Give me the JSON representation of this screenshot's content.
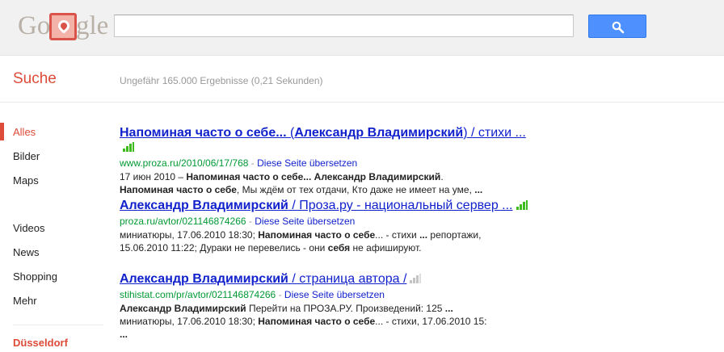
{
  "header": {
    "logo_left": "Go",
    "logo_right": "gle",
    "search_value": "",
    "search_button_icon": "search-icon"
  },
  "subheader": {
    "section_title": "Suche",
    "stats": "Ungefähr 165.000 Ergebnisse (0,21 Sekunden)"
  },
  "nav": {
    "items": [
      "Alles",
      "Bilder",
      "Maps",
      "Videos",
      "News",
      "Shopping",
      "Mehr"
    ],
    "active": "Alles",
    "location": "Düsseldorf"
  },
  "results": [
    {
      "title_parts": [
        "Напоминая часто о себе...",
        " (",
        "Александр Владимирский",
        ") / стихи ..."
      ],
      "url": "www.proza.ru/2010/06/17/768",
      "translate": "Diese Seite übersetzen",
      "snippet_line1": [
        "17 июн 2010 – ",
        "Напоминая часто о себе...",
        " ",
        "Александр Владимирский",
        "."
      ],
      "snippet_line2": [
        "Напоминая часто о себе",
        ", Мы ждём от тех отдачи, Кто даже не имеет на уме, ",
        "..."
      ],
      "signal": "green"
    },
    {
      "title_parts": [
        "Александр Владимирский",
        " / Проза.ру - национальный сервер ..."
      ],
      "url": "proza.ru/avtor/021146874266",
      "translate": "Diese Seite übersetzen",
      "snippet_line1": [
        "миниатюры, 17.06.2010 18:30; ",
        "Напоминая часто о себе",
        "... - стихи ",
        "...",
        " репортажи,"
      ],
      "snippet_line2": [
        "15.06.2010 11:22; Дураки не перевелись - они ",
        "себя",
        " не афишируют."
      ],
      "signal": "green"
    },
    {
      "title_parts": [
        "Александр Владимирский",
        " / страница автора /"
      ],
      "url": "stihistat.com/pr/avtor/021146874266",
      "translate": "Diese Seite übersetzen",
      "snippet_line1": [
        "Александр Владимирский",
        " Перейти на ПРОЗА.РУ. Произведений: 125 ",
        "..."
      ],
      "snippet_line2": [
        "миниатюры, 17.06.2010 18:30; ",
        "Напоминая часто о себе",
        "... - стихи, 17.06.2010 15:"
      ],
      "snippet_line3": "...",
      "signal": "gray"
    }
  ],
  "colors": {
    "brand_red": "#dd4b39",
    "link_blue": "#1122cc",
    "url_green": "#009933",
    "button_blue": "#4d90fe"
  }
}
